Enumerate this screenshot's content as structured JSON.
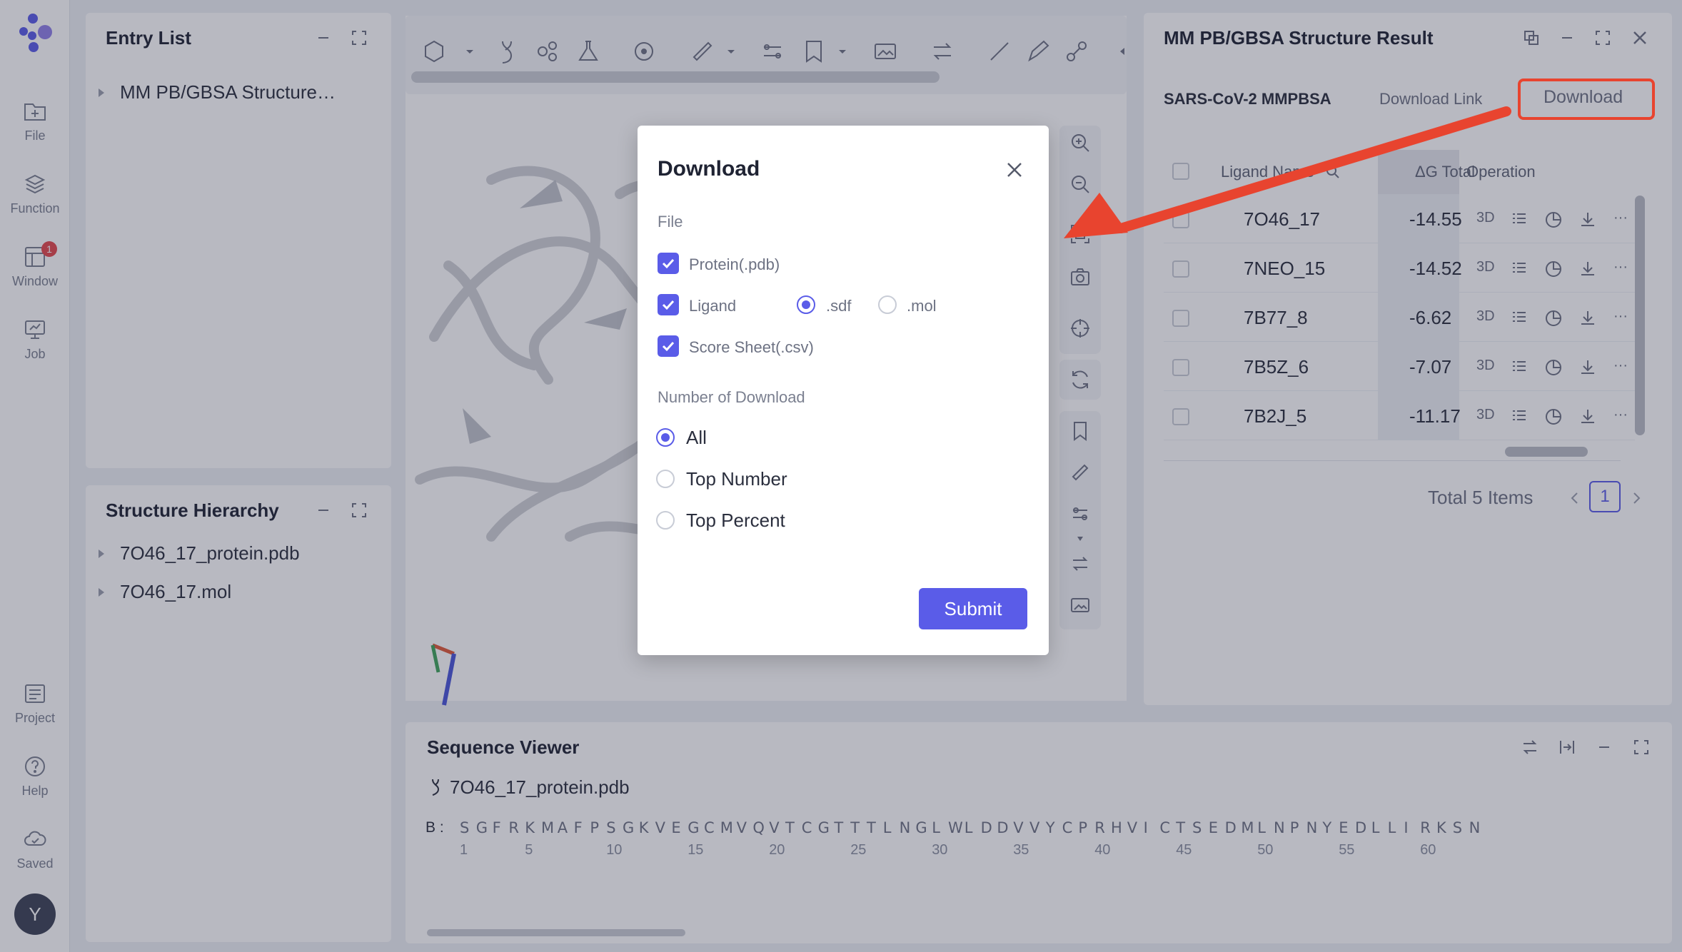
{
  "rail": {
    "items": [
      {
        "label": "File",
        "icon": "file-plus-icon"
      },
      {
        "label": "Function",
        "icon": "function-icon"
      },
      {
        "label": "Window",
        "icon": "window-icon",
        "badge": "1"
      },
      {
        "label": "Job",
        "icon": "job-icon"
      },
      {
        "label": "Project",
        "icon": "project-icon"
      },
      {
        "label": "Help",
        "icon": "help-icon"
      },
      {
        "label": "Saved",
        "icon": "cloud-icon"
      }
    ],
    "avatar": "Y"
  },
  "entry_list": {
    "title": "Entry List",
    "items": [
      "MM PB/GBSA Structure…"
    ]
  },
  "structure_hierarchy": {
    "title": "Structure Hierarchy",
    "items": [
      "7O46_17_protein.pdb",
      "7O46_17.mol"
    ]
  },
  "result": {
    "title": "MM PB/GBSA Structure Result",
    "tabs": [
      "SARS-CoV-2 MMPBSA",
      "Download Link",
      "Download"
    ],
    "columns": {
      "name": "Ligand Name",
      "dg": "ΔG Total",
      "operation": "Operation"
    },
    "rows": [
      {
        "name": "7O46_17",
        "dg": "-14.55"
      },
      {
        "name": "7NEO_15",
        "dg": "-14.52"
      },
      {
        "name": "7B77_8",
        "dg": "-6.62"
      },
      {
        "name": "7B5Z_6",
        "dg": "-7.07"
      },
      {
        "name": "7B2J_5",
        "dg": "-11.17"
      }
    ],
    "op_label": "3D",
    "more": "···",
    "total": "Total 5 Items",
    "page": "1"
  },
  "sequence": {
    "title": "Sequence Viewer",
    "file": "7O46_17_protein.pdb",
    "chain": "B :",
    "letters": [
      "S",
      "G",
      "F",
      "R",
      "K",
      "M",
      "A",
      "F",
      "P",
      "S",
      "G",
      "K",
      "V",
      "E",
      "G",
      "C",
      "M",
      "V",
      "Q",
      "V",
      "T",
      "C",
      "G",
      "T",
      "T",
      "T",
      "L",
      "N",
      "G",
      "L",
      "W",
      "L",
      "D",
      "D",
      "V",
      "V",
      "Y",
      "C",
      "P",
      "R",
      "H",
      "V",
      "I",
      "C",
      "T",
      "S",
      "E",
      "D",
      "M",
      "L",
      "N",
      "P",
      "N",
      "Y",
      "E",
      "D",
      "L",
      "L",
      "I",
      "R",
      "K",
      "S",
      "N"
    ],
    "numbers": [
      "1",
      "5",
      "10",
      "15",
      "20",
      "25",
      "30",
      "35",
      "40",
      "45",
      "50",
      "55",
      "60"
    ]
  },
  "modal": {
    "title": "Download",
    "file_section": "File",
    "options": {
      "protein": "Protein(.pdb)",
      "ligand": "Ligand",
      "sdf": ".sdf",
      "mol": ".mol",
      "score": "Score Sheet(.csv)"
    },
    "number_section": "Number of Download",
    "radios": [
      "All",
      "Top Number",
      "Top Percent"
    ],
    "submit": "Submit"
  },
  "colors": {
    "accent": "#5a5ce8",
    "highlight": "#e8442f"
  }
}
